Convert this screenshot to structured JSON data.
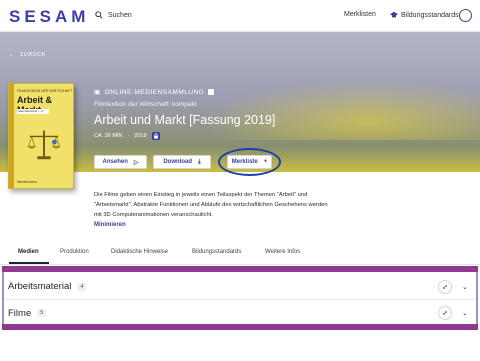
{
  "nav": {
    "logo": "SESAM",
    "search_label": "Suchen",
    "merklisten": "Merklisten",
    "bildungsstandards": "Bildungsstandards"
  },
  "hero": {
    "back_label": "ZURÜCK",
    "collection": "ONLINE-MEDIENSAMMLUNG",
    "subtitle": "Filmlexikon der Wirtschaft: kompakt",
    "title": "Arbeit und Markt [Fassung 2019]",
    "duration": "CA. 26 MIN",
    "year": "2019",
    "cover": {
      "top": "FILMLEXIKON DER WIRTSCHAFT",
      "title": "Arbeit & Markt",
      "badge": "Sekundarstufe I - II",
      "bottom": "Westermann"
    }
  },
  "actions": {
    "ansehen": "Ansehen",
    "download": "Download",
    "merkliste": "Merkliste"
  },
  "description": "Die Filme geben einen Einstieg in jeweils einen Teilaspekt der Themen \"Arbeit\" und \"Arbeitsmarkt\". Abstrakte Funktionen und Abläufe des wirtschaftlichen Geschehens werden mit 3D Computeranimationen veranschaulicht.",
  "minimize": "Minimieren",
  "tabs": [
    "Medien",
    "Produktion",
    "Didaktische Hinweise",
    "Bildungsstandards",
    "Weitere Infos"
  ],
  "media": [
    {
      "label": "Arbeitsmaterial",
      "count": "4"
    },
    {
      "label": "Filme",
      "count": "5"
    }
  ],
  "colors": {
    "accent": "#3b3fa3",
    "highlight_ring": "#1a3fb0",
    "band": "#8f3a90"
  }
}
